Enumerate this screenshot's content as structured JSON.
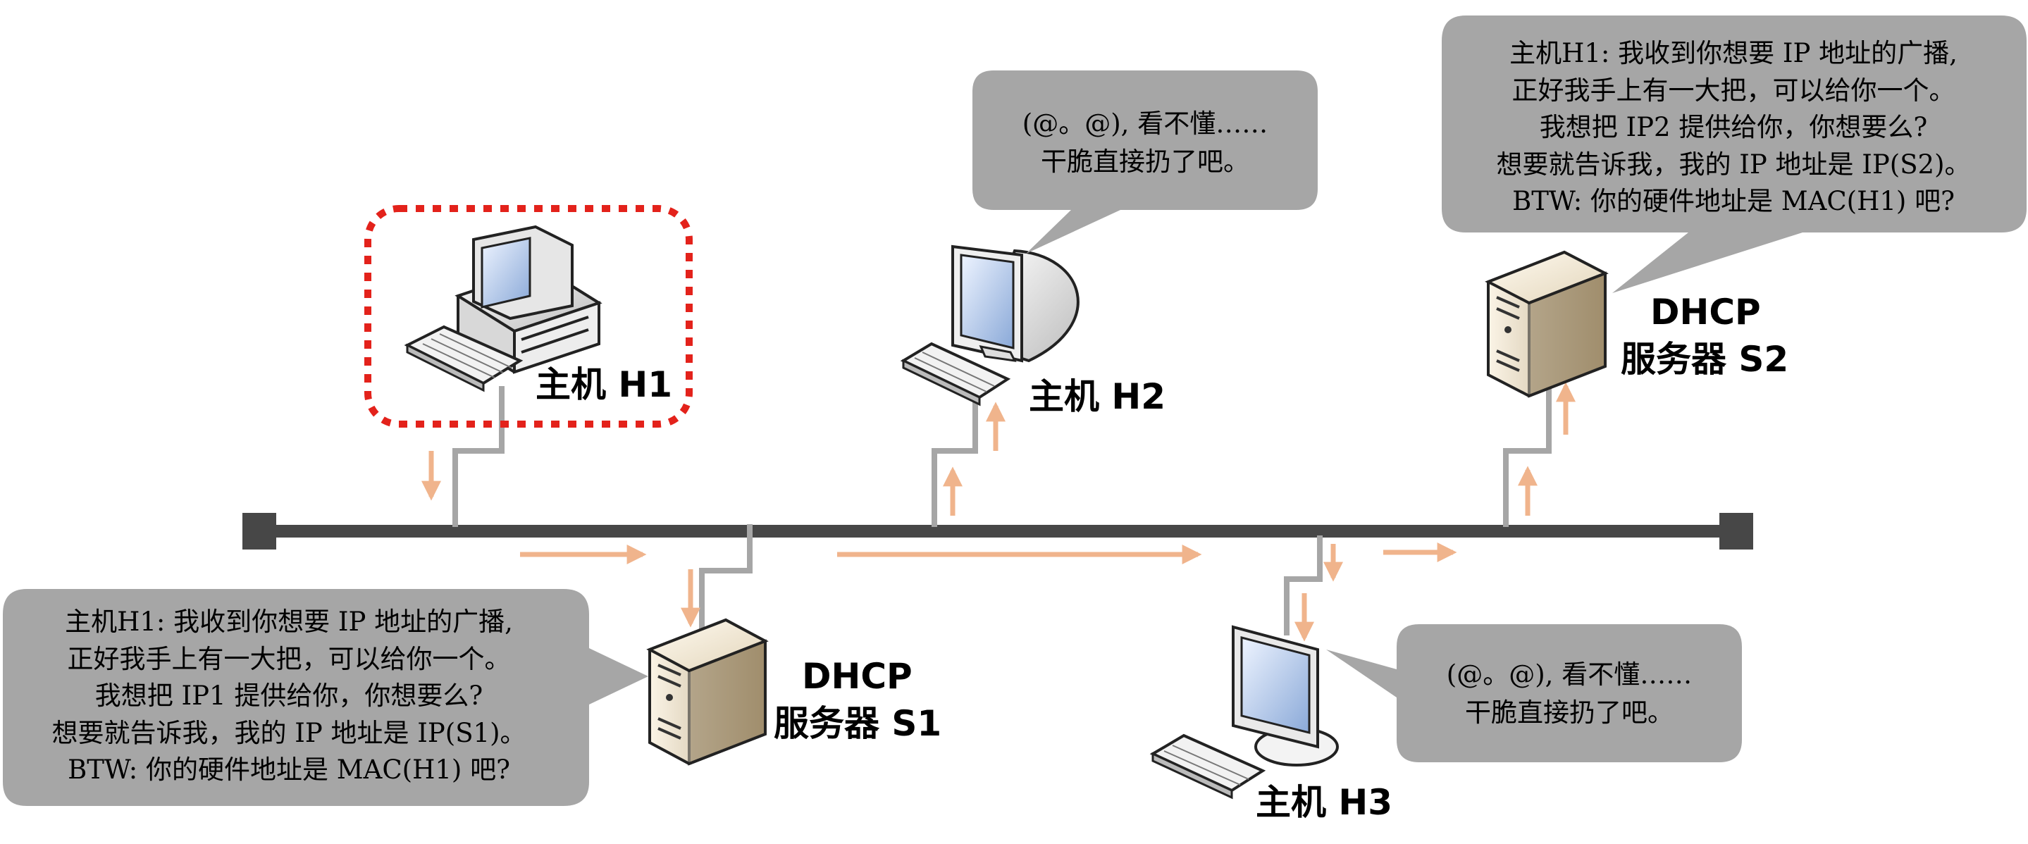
{
  "nodes": {
    "h1": {
      "label": "主机 H1"
    },
    "h2": {
      "label": "主机 H2"
    },
    "h3": {
      "label": "主机 H3"
    },
    "s1": {
      "label_line1": "DHCP",
      "label_line2": "服务器 S1"
    },
    "s2": {
      "label_line1": "DHCP",
      "label_line2": "服务器 S2"
    }
  },
  "bubbles": {
    "h2": {
      "lines": [
        "(@。@), 看不懂……",
        "干脆直接扔了吧。"
      ]
    },
    "h3": {
      "lines": [
        "(@。@), 看不懂……",
        "干脆直接扔了吧。"
      ]
    },
    "s1": {
      "lines": [
        "主机H1: 我收到你想要 IP 地址的广播,",
        "正好我手上有一大把，可以给你一个。",
        "我想把 IP1 提供给你，你想要么?",
        "想要就告诉我，我的 IP 地址是 IP(S1)。",
        "BTW: 你的硬件地址是 MAC(H1) 吧?"
      ]
    },
    "s2": {
      "lines": [
        "主机H1: 我收到你想要 IP 地址的广播,",
        "正好我手上有一大把，可以给你一个。",
        "我想把 IP2 提供给你，你想要么?",
        "想要就告诉我，我的 IP 地址是 IP(S2)。",
        "BTW: 你的硬件地址是 MAC(H1) 吧?"
      ]
    }
  },
  "colors": {
    "bus": "#474747",
    "link": "#a6a6a6",
    "arrow": "#f0b48c",
    "bubble": "#a6a6a6",
    "highlight": "#e3221b"
  }
}
